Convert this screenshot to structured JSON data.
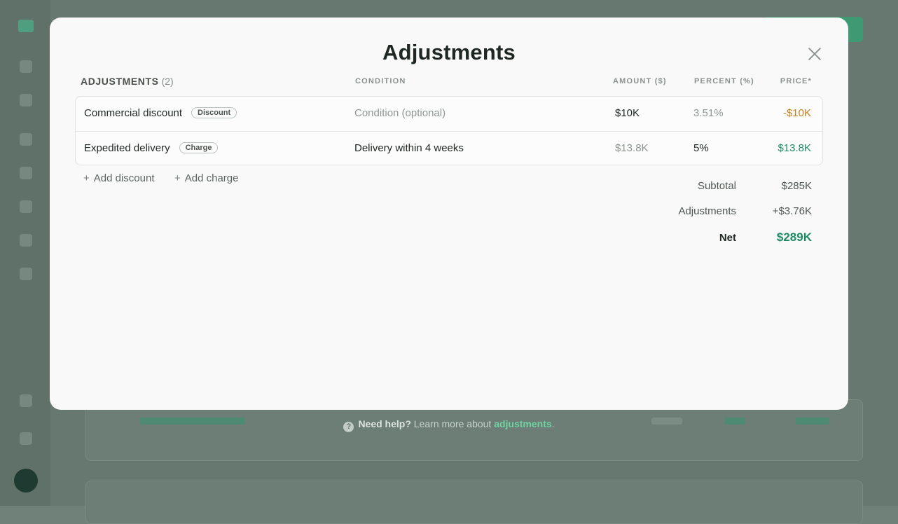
{
  "modal": {
    "title": "Adjustments",
    "close_icon": "close-icon"
  },
  "table": {
    "section_label": "ADJUSTMENTS",
    "count": "(2)",
    "headers": {
      "condition": "CONDITION",
      "amount": "AMOUNT ($)",
      "percent": "PERCENT (%)",
      "price": "PRICE*"
    },
    "rows": [
      {
        "name": "Commercial discount",
        "tag": "Discount",
        "condition": "Condition (optional)",
        "amount": "$10K",
        "percent": "3.51%",
        "price": "-$10K"
      },
      {
        "name": "Expedited delivery",
        "tag": "Charge",
        "condition": "Delivery within 4 weeks",
        "amount": "$13.8K",
        "percent": "5%",
        "price": "$13.8K"
      }
    ]
  },
  "actions": {
    "add_discount": "Add discount",
    "add_charge": "Add charge",
    "plus_glyph": "+"
  },
  "summary": {
    "subtotal_label": "Subtotal",
    "subtotal_value": "$285K",
    "adjustments_label": "Adjustments",
    "adjustments_value": "+$3.76K",
    "net_label": "Net",
    "net_value": "$289K"
  },
  "help": {
    "icon": "question-icon",
    "glyph": "?",
    "bold": "Need help?",
    "text": " Learn more about ",
    "link": "adjustments",
    "end": "."
  },
  "colors": {
    "accent": "#1f8a66",
    "negative": "#c4801f",
    "link": "#6fd3a6"
  }
}
